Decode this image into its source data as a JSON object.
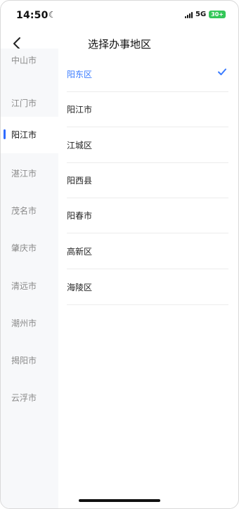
{
  "status_bar": {
    "time": "14:50",
    "network": "5G",
    "battery": "30+"
  },
  "nav": {
    "title": "选择办事地区"
  },
  "cities": [
    {
      "label": "中山市",
      "selected": false
    },
    {
      "label": "江门市",
      "selected": false
    },
    {
      "label": "阳江市",
      "selected": true
    },
    {
      "label": "湛江市",
      "selected": false
    },
    {
      "label": "茂名市",
      "selected": false
    },
    {
      "label": "肇庆市",
      "selected": false
    },
    {
      "label": "清远市",
      "selected": false
    },
    {
      "label": "潮州市",
      "selected": false
    },
    {
      "label": "揭阳市",
      "selected": false
    },
    {
      "label": "云浮市",
      "selected": false
    }
  ],
  "districts": [
    {
      "label": "阳东区",
      "selected": true
    },
    {
      "label": "阳江市",
      "selected": false
    },
    {
      "label": "江城区",
      "selected": false
    },
    {
      "label": "阳西县",
      "selected": false
    },
    {
      "label": "阳春市",
      "selected": false
    },
    {
      "label": "高新区",
      "selected": false
    },
    {
      "label": "海陵区",
      "selected": false
    }
  ],
  "colors": {
    "accent": "#3a7bff",
    "active_bar": "#2f6bff",
    "battery": "#34c759"
  }
}
